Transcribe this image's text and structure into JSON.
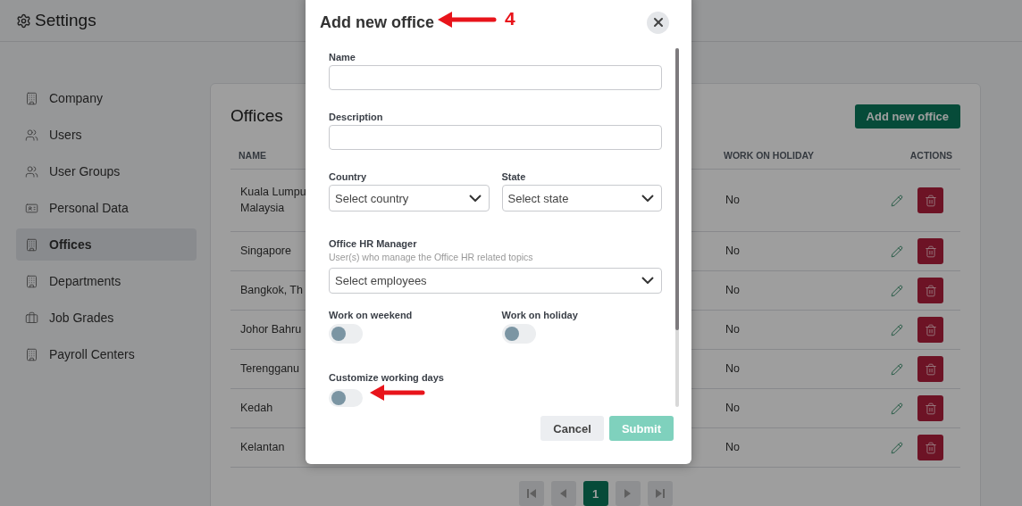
{
  "header": {
    "title": "Settings"
  },
  "sidebar": {
    "items": [
      {
        "label": "Company",
        "kind": "building",
        "selected": false
      },
      {
        "label": "Users",
        "kind": "users",
        "selected": false
      },
      {
        "label": "User Groups",
        "kind": "users",
        "selected": false
      },
      {
        "label": "Personal Data",
        "kind": "id-card",
        "selected": false
      },
      {
        "label": "Offices",
        "kind": "building",
        "selected": true
      },
      {
        "label": "Departments",
        "kind": "building",
        "selected": false
      },
      {
        "label": "Job Grades",
        "kind": "briefcase",
        "selected": false
      },
      {
        "label": "Payroll Centers",
        "kind": "building",
        "selected": false
      }
    ]
  },
  "panel": {
    "title": "Offices",
    "add_button": "Add new office",
    "table": {
      "columns": [
        "NAME",
        "WORK ON HOLIDAY",
        "ACTIONS"
      ],
      "rows": [
        {
          "name": "Kuala Lumpu\nMalaysia",
          "work_on_holiday": "No"
        },
        {
          "name": "Singapore",
          "work_on_holiday": "No"
        },
        {
          "name": "Bangkok, Th",
          "work_on_holiday": "No"
        },
        {
          "name": "Johor Bahru",
          "work_on_holiday": "No"
        },
        {
          "name": "Terengganu",
          "work_on_holiday": "No"
        },
        {
          "name": "Kedah",
          "work_on_holiday": "No"
        },
        {
          "name": "Kelantan",
          "work_on_holiday": "No"
        }
      ]
    },
    "pagination": [
      {
        "kind": "first"
      },
      {
        "kind": "prev"
      },
      {
        "kind": "page",
        "label": "1",
        "selected": true
      },
      {
        "kind": "next"
      },
      {
        "kind": "last"
      }
    ]
  },
  "dialog": {
    "title": "Add new office",
    "annotation": "4",
    "fields": {
      "name": {
        "label": "Name"
      },
      "description": {
        "label": "Description"
      },
      "country": {
        "label": "Country",
        "placeholder": "Select country"
      },
      "state": {
        "label": "State",
        "placeholder": "Select state"
      },
      "hr_manager": {
        "label": "Office HR Manager",
        "hint": "User(s) who manage the Office HR related topics",
        "placeholder": "Select employees"
      }
    },
    "toggles": [
      {
        "label": "Work on weekend",
        "on": false
      },
      {
        "label": "Work on holiday",
        "on": false
      }
    ],
    "customize": {
      "label": "Customize working days",
      "on": false
    },
    "buttons": {
      "cancel": "Cancel",
      "submit": "Submit"
    }
  }
}
